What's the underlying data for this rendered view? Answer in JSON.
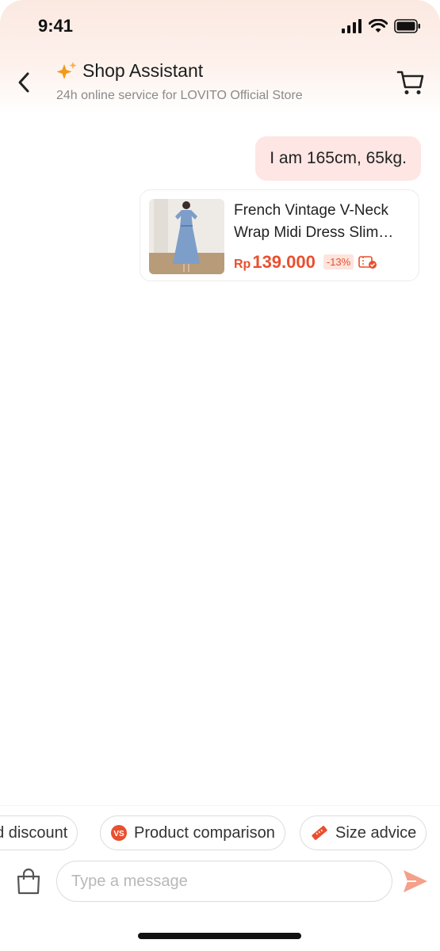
{
  "status_bar": {
    "time": "9:41"
  },
  "header": {
    "title": "Shop Assistant",
    "subtitle": "24h online service for LOVITO Official Store",
    "title_icon": "sparkle-icon",
    "back_icon": "chevron-left-icon",
    "cart_icon": "cart-icon",
    "accent_color": "#f29a18"
  },
  "messages": [
    {
      "type": "user_text",
      "text": "I am 165cm, 65kg."
    }
  ],
  "product_card": {
    "name": "French Vintage V-Neck Wrap Midi Dress Slim…",
    "currency": "Rp",
    "price": "139.000",
    "discount": "-13%",
    "voucher_icon": "voucher-check-icon",
    "price_color": "#e8502f"
  },
  "quick_actions": [
    {
      "label": "nd discount",
      "icon": ""
    },
    {
      "label": "Product comparison",
      "icon": "vs-icon"
    },
    {
      "label": "Size advice",
      "icon": "ruler-icon"
    }
  ],
  "composer": {
    "placeholder": "Type a message",
    "bag_icon": "shopping-bag-icon",
    "send_icon": "send-icon",
    "send_color": "#f4a08a"
  }
}
